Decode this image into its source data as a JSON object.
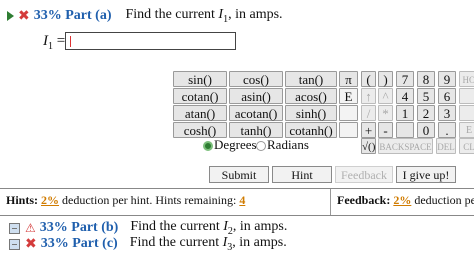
{
  "part_a": {
    "percent_part": "33% Part (a)",
    "text_prefix": "Find the current ",
    "var": "I",
    "sub": "1",
    "text_suffix": ", in amps."
  },
  "answer": {
    "label_var": "I",
    "label_sub": "1",
    "equals": " =",
    "value": ""
  },
  "keypad": {
    "functions": [
      [
        "sin()",
        "cos()",
        "tan()"
      ],
      [
        "cotan()",
        "asin()",
        "acos()"
      ],
      [
        "atan()",
        "acotan()",
        "sinh()"
      ],
      [
        "cosh()",
        "tanh()",
        "cotanh()"
      ]
    ],
    "pi": "π",
    "e": "E",
    "paren_open": "(",
    "paren_close": ")",
    "up": "↑",
    "up_caret": "^",
    "divide": "/",
    "multiply": "*",
    "plus": "+",
    "minus": "-",
    "sqrt": "√()",
    "digits": [
      "7",
      "8",
      "9",
      "4",
      "5",
      "6",
      "1",
      "2",
      "3"
    ],
    "zero": "0",
    "dot": ".",
    "backspace": "BACKSPACE",
    "del": "DEL",
    "home": "HO",
    "end": "E",
    "clear": "CL",
    "degrees": "Degrees",
    "radians": "Radians"
  },
  "actions": {
    "submit": "Submit",
    "hint": "Hint",
    "feedback": "Feedback",
    "give_up": "I give up!"
  },
  "hints": {
    "label": "Hints:",
    "percent": "2%",
    "text": "deduction per hint. Hints remaining:",
    "remaining": "4"
  },
  "feedback": {
    "label": "Feedback:",
    "percent": "2%",
    "text": "deduction per feedb"
  },
  "part_b": {
    "percent_part": "33% Part (b)",
    "text_prefix": "Find the current ",
    "var": "I",
    "sub": "2",
    "text_suffix": ", in amps."
  },
  "part_c": {
    "percent_part": "33% Part (c)",
    "text_prefix": "Find the current ",
    "var": "I",
    "sub": "3",
    "text_suffix": ", in amps."
  },
  "colors": {
    "part_blue": "#1f5fad",
    "hint_orange": "#d07b00",
    "status_red": "#d43b3b",
    "radio_green": "#2e7d32"
  }
}
